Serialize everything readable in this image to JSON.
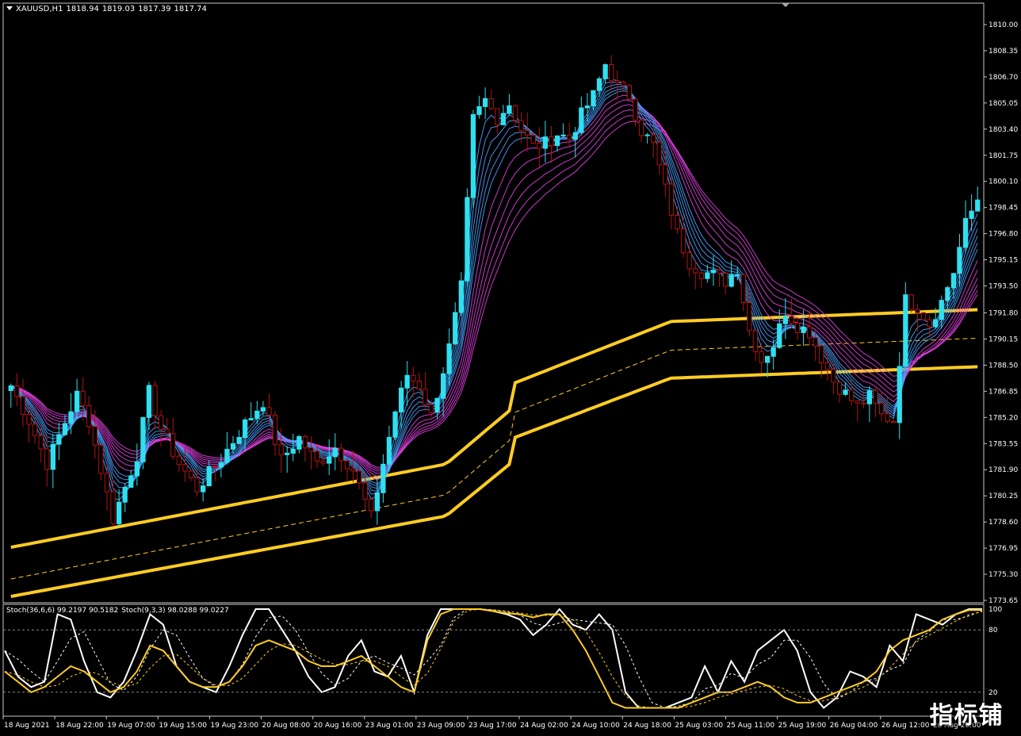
{
  "window": {
    "symbol": "XAUUSD,H1",
    "ohlc": [
      "1818.94",
      "1819.03",
      "1817.39",
      "1817.74"
    ]
  },
  "sub_indicator": {
    "stoch1": "Stoch(36,6,6) 99.2197 90.5182",
    "stoch2": "Stoch(9,3,3) 98.0288 99.0227"
  },
  "watermark": "指标铺",
  "colors": {
    "background": "#000000",
    "candle_up": "#2ee0f0",
    "candle_down": "#b01414",
    "ema_fast": "#4aa0ff",
    "ema_slow": "#e040e0",
    "band": "#ffcc22",
    "stoch_main": "#ffffff",
    "stoch_slow": "#ffcc22"
  },
  "chart_data": [
    {
      "type": "candlestick",
      "symbol": "XAUUSD",
      "timeframe": "H1",
      "ylim": [
        1773.65,
        1811.0
      ],
      "y_ticks": [
        "1810.00",
        "1808.35",
        "1806.70",
        "1805.05",
        "1803.40",
        "1801.75",
        "1800.10",
        "1798.45",
        "1796.80",
        "1795.15",
        "1793.50",
        "1791.80",
        "1790.15",
        "1788.50",
        "1786.85",
        "1785.20",
        "1783.55",
        "1781.90",
        "1780.25",
        "1778.60",
        "1776.95",
        "1775.30",
        "1773.65"
      ],
      "x_ticks": [
        "18 Aug 2021",
        "18 Aug 22:00",
        "19 Aug 07:00",
        "19 Aug 15:00",
        "19 Aug 23:00",
        "20 Aug 08:00",
        "20 Aug 16:00",
        "23 Aug 01:00",
        "23 Aug 09:00",
        "23 Aug 17:00",
        "24 Aug 02:00",
        "24 Aug 10:00",
        "24 Aug 18:00",
        "25 Aug 03:00",
        "25 Aug 11:00",
        "25 Aug 19:00",
        "26 Aug 04:00",
        "26 Aug 12:00",
        "26 Aug 20:00"
      ],
      "close_path": [
        [
          0,
          1787.2
        ],
        [
          3,
          1785.0
        ],
        [
          6,
          1782.3
        ],
        [
          9,
          1784.9
        ],
        [
          11,
          1786.6
        ],
        [
          13,
          1785.0
        ],
        [
          15,
          1781.9
        ],
        [
          17,
          1778.8
        ],
        [
          19,
          1780.8
        ],
        [
          21,
          1782.8
        ],
        [
          23,
          1786.8
        ],
        [
          25,
          1784.5
        ],
        [
          28,
          1782.3
        ],
        [
          31,
          1780.7
        ],
        [
          35,
          1782.6
        ],
        [
          39,
          1784.8
        ],
        [
          42,
          1786.2
        ],
        [
          45,
          1782.5
        ],
        [
          48,
          1783.9
        ],
        [
          51,
          1782.3
        ],
        [
          54,
          1783.3
        ],
        [
          57,
          1781.9
        ],
        [
          60,
          1778.9
        ],
        [
          62,
          1782.3
        ],
        [
          64,
          1785.6
        ],
        [
          66,
          1787.9
        ],
        [
          68,
          1787.2
        ],
        [
          70,
          1785.3
        ],
        [
          73,
          1789.6
        ],
        [
          75,
          1793.4
        ],
        [
          77,
          1804.0
        ],
        [
          79,
          1805.2
        ],
        [
          81,
          1804.1
        ],
        [
          83,
          1805.0
        ],
        [
          85,
          1803.4
        ],
        [
          87,
          1802.3
        ],
        [
          89,
          1802.5
        ],
        [
          91,
          1803.1
        ],
        [
          93,
          1802.8
        ],
        [
          95,
          1804.3
        ],
        [
          97,
          1805.5
        ],
        [
          99,
          1807.5
        ],
        [
          101,
          1806.1
        ],
        [
          103,
          1805.5
        ],
        [
          105,
          1803.3
        ],
        [
          107,
          1802.4
        ],
        [
          109,
          1799.6
        ],
        [
          111,
          1796.8
        ],
        [
          113,
          1795.0
        ],
        [
          115,
          1794.4
        ],
        [
          117,
          1794.2
        ],
        [
          119,
          1793.8
        ],
        [
          121,
          1794.6
        ],
        [
          123,
          1790.7
        ],
        [
          125,
          1788.8
        ],
        [
          127,
          1789.8
        ],
        [
          129,
          1791.9
        ],
        [
          131,
          1791.0
        ],
        [
          133,
          1790.6
        ],
        [
          135,
          1789.0
        ],
        [
          137,
          1787.5
        ],
        [
          139,
          1786.7
        ],
        [
          141,
          1785.9
        ],
        [
          143,
          1786.5
        ],
        [
          145,
          1785.3
        ],
        [
          147,
          1785.0
        ],
        [
          149,
          1792.6
        ],
        [
          151,
          1792.2
        ],
        [
          153,
          1791.1
        ],
        [
          155,
          1792.5
        ],
        [
          157,
          1794.4
        ],
        [
          159,
          1797.4
        ],
        [
          161,
          1799.0
        ]
      ],
      "overlays": {
        "ema_fast_group": 6,
        "ema_slow_group": 6,
        "band_upper_start": 1777.0,
        "band_upper_end": 1792.0,
        "band_mid_start": 1775.0,
        "band_mid_end": 1790.2,
        "band_lower_start": 1773.9,
        "band_lower_end": 1788.4
      }
    },
    {
      "type": "line",
      "title": "Stoch(36,6,6) / Stoch(9,3,3)",
      "ylim": [
        0,
        100
      ],
      "y_ticks": [
        "100",
        "80",
        "20"
      ],
      "levels": [
        80,
        20
      ],
      "series": [
        {
          "name": "Stoch(9,3,3)",
          "values": [
            60,
            35,
            25,
            30,
            95,
            90,
            50,
            20,
            15,
            30,
            60,
            95,
            85,
            45,
            30,
            25,
            20,
            45,
            75,
            100,
            100,
            80,
            60,
            35,
            20,
            25,
            55,
            70,
            40,
            35,
            55,
            20,
            75,
            100,
            100,
            100,
            100,
            98,
            95,
            90,
            75,
            85,
            100,
            85,
            80,
            95,
            80,
            20,
            5,
            5,
            5,
            10,
            15,
            45,
            20,
            50,
            30,
            60,
            70,
            80,
            60,
            20,
            5,
            15,
            40,
            35,
            25,
            65,
            50,
            95,
            90,
            85,
            95,
            100,
            100
          ]
        },
        {
          "name": "Stoch(36,6,6)",
          "values": [
            40,
            30,
            20,
            25,
            35,
            45,
            40,
            30,
            20,
            25,
            40,
            65,
            60,
            45,
            30,
            25,
            25,
            30,
            45,
            65,
            70,
            65,
            60,
            50,
            45,
            45,
            50,
            55,
            45,
            35,
            25,
            20,
            70,
            95,
            100,
            100,
            100,
            98,
            96,
            95,
            92,
            95,
            95,
            80,
            60,
            35,
            10,
            5,
            5,
            5,
            5,
            5,
            10,
            15,
            20,
            20,
            25,
            30,
            25,
            15,
            10,
            10,
            15,
            20,
            25,
            30,
            40,
            60,
            70,
            75,
            80,
            90,
            95,
            99,
            99
          ]
        }
      ]
    }
  ]
}
